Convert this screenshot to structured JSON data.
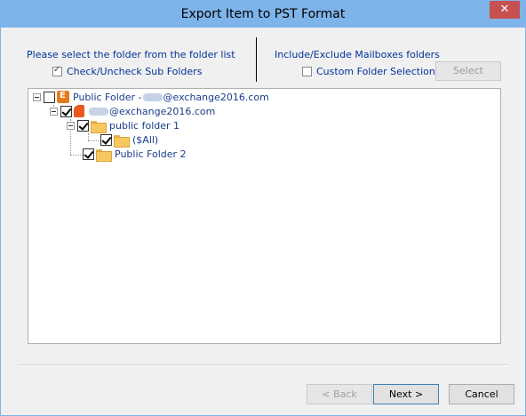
{
  "window": {
    "title": "Export Item to PST Format",
    "close_label": "✕"
  },
  "left_panel": {
    "instruction": "Please select the folder from the folder list",
    "check_subfolders_label": "Check/Uncheck Sub Folders",
    "check_subfolders_checked": true
  },
  "right_panel": {
    "instruction": "Include/Exclude Mailboxes folders",
    "custom_selection_label": "Custom Folder Selection",
    "custom_selection_checked": false,
    "select_button": "Select"
  },
  "tree": {
    "nodes": [
      {
        "label_prefix": "Public Folder - ",
        "label_suffix": "@exchange2016.com",
        "checked": false,
        "icon": "exchange-icon",
        "expanded": true
      },
      {
        "label_prefix": "",
        "label_suffix": "@exchange2016.com",
        "checked": true,
        "icon": "mailbox-icon",
        "expanded": true
      },
      {
        "label": "public folder 1",
        "checked": true,
        "icon": "folder-icon",
        "expanded": true
      },
      {
        "label": "($All)",
        "checked": true,
        "icon": "folder-icon"
      },
      {
        "label": "Public Folder 2",
        "checked": true,
        "icon": "folder-icon"
      }
    ]
  },
  "footer": {
    "back": "< Back",
    "next": "Next >",
    "cancel": "Cancel"
  },
  "colors": {
    "titlebar": "#7eb4ea",
    "label_blue": "#003399",
    "close_red": "#c75050"
  }
}
